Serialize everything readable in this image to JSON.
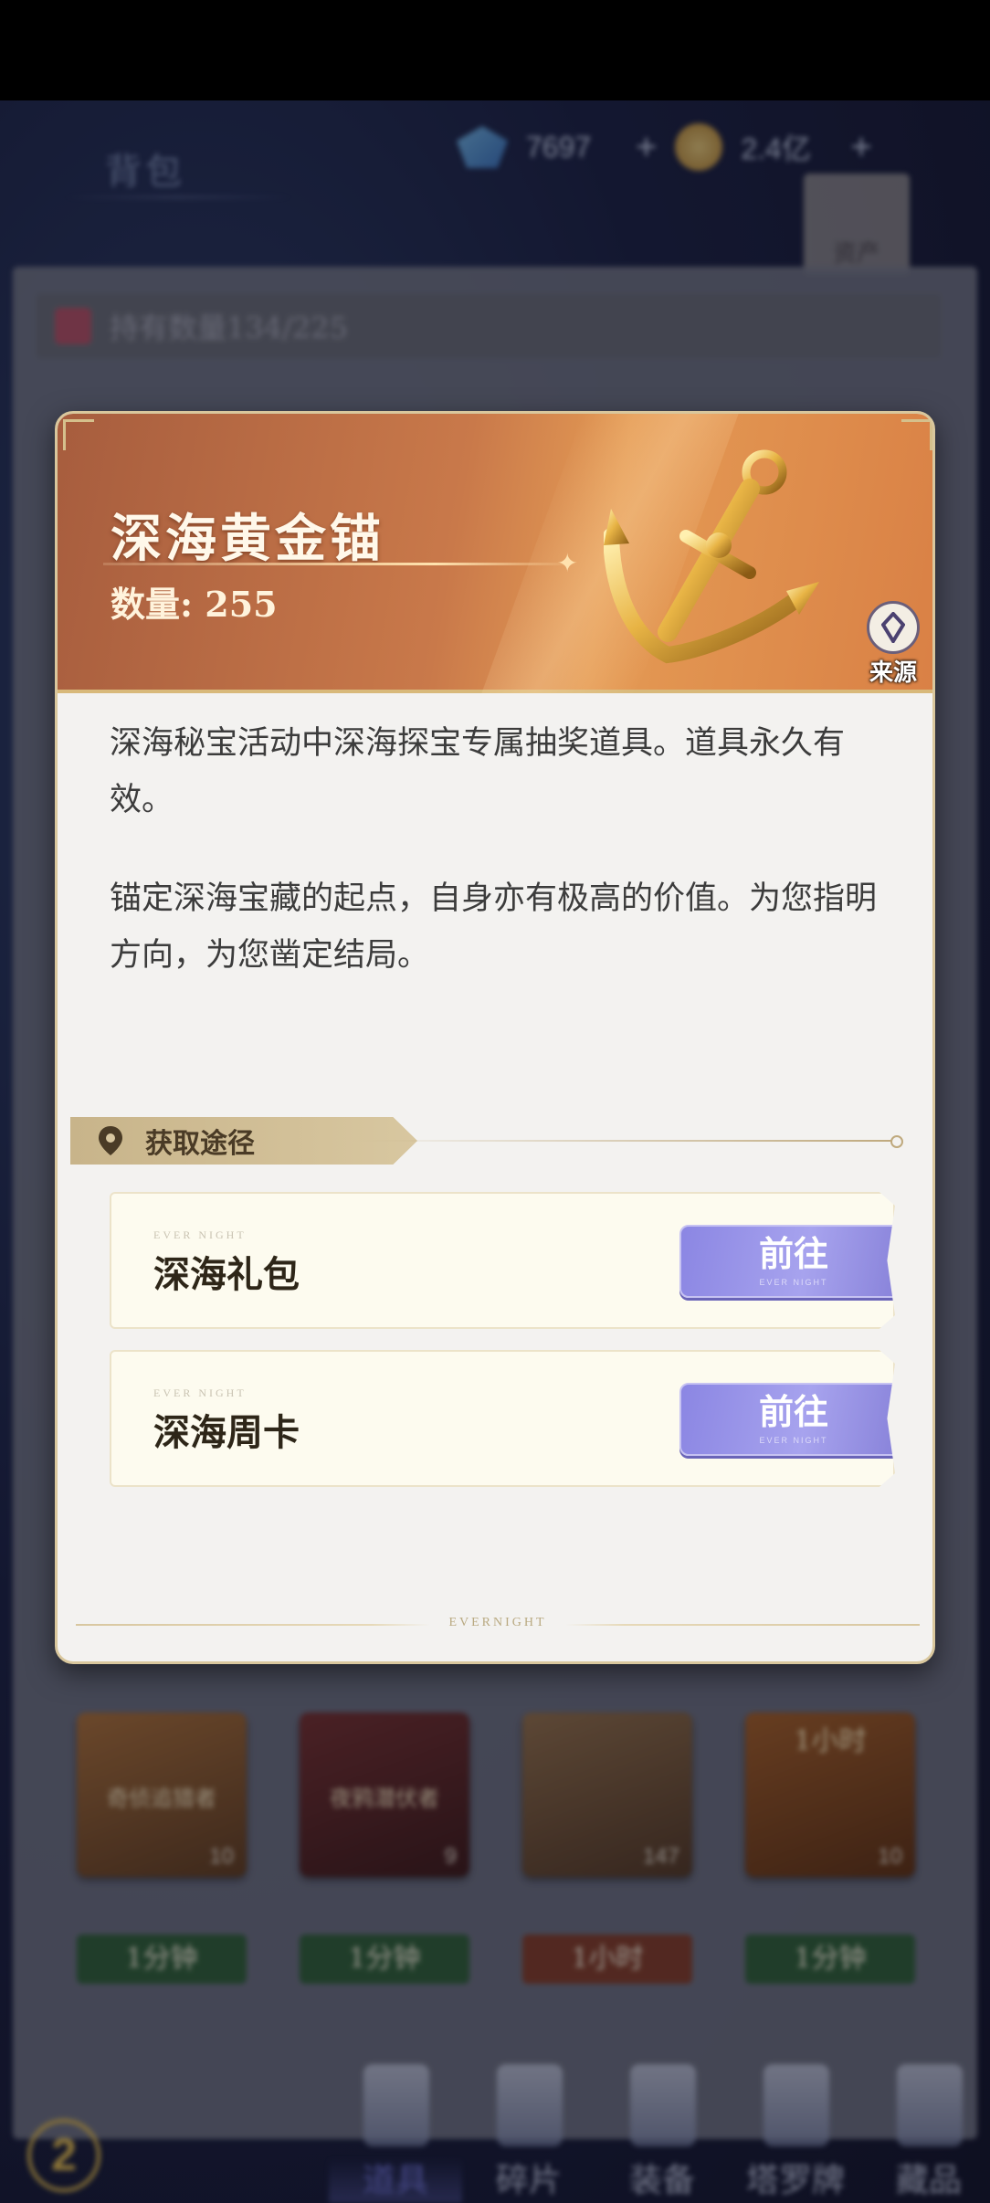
{
  "background": {
    "title": "背包",
    "currency": [
      {
        "icon": "gem-icon",
        "value": "7697"
      },
      {
        "icon": "coin-icon",
        "value": "2.4亿"
      }
    ],
    "asset_label": "资产",
    "capacity_text": "持有数量134/225",
    "tiles": [
      {
        "label": "奇侦追猎者",
        "count": "10",
        "color": "#8a5a30"
      },
      {
        "label": "夜鸦潜伏者",
        "count": "9",
        "color": "#5a2a2a"
      },
      {
        "label": "",
        "count": "147",
        "color": "#7a5a3a"
      },
      {
        "label": "1小时",
        "count": "10",
        "color": "#8a4a20"
      }
    ],
    "time_chips": [
      {
        "label": "1分钟",
        "color": "#2d5a36"
      },
      {
        "label": "1分钟",
        "color": "#2d5a36"
      },
      {
        "label": "1小时",
        "color": "#7a3a28"
      },
      {
        "label": "1分钟",
        "color": "#2d5a36"
      }
    ],
    "nav_tabs": [
      "道具",
      "碎片",
      "装备",
      "塔罗牌",
      "藏品"
    ],
    "active_tab": "道具"
  },
  "item": {
    "name": "深海黄金锚",
    "quantity_label": "数量:",
    "quantity": "255",
    "source_label": "来源",
    "description_1": "深海秘宝活动中深海探宝专属抽奖道具。道具永久有效。",
    "description_2": "锚定深海宝藏的起点，自身亦有极高的价值。为您指明方向，为您凿定结局。"
  },
  "acquisition": {
    "header": "获取途径",
    "routes": [
      {
        "sub": "EVER NIGHT",
        "name": "深海礼包",
        "button": "前往",
        "button_sub": "EVER NIGHT"
      },
      {
        "sub": "EVER NIGHT",
        "name": "深海周卡",
        "button": "前往",
        "button_sub": "EVER NIGHT"
      }
    ]
  },
  "footer_brand": "EVERNIGHT",
  "colors": {
    "header_gradient_start": "#a75d3e",
    "header_gradient_end": "#e49a54",
    "go_button": "#8b86e3",
    "card_bg": "#f3f2f0"
  }
}
